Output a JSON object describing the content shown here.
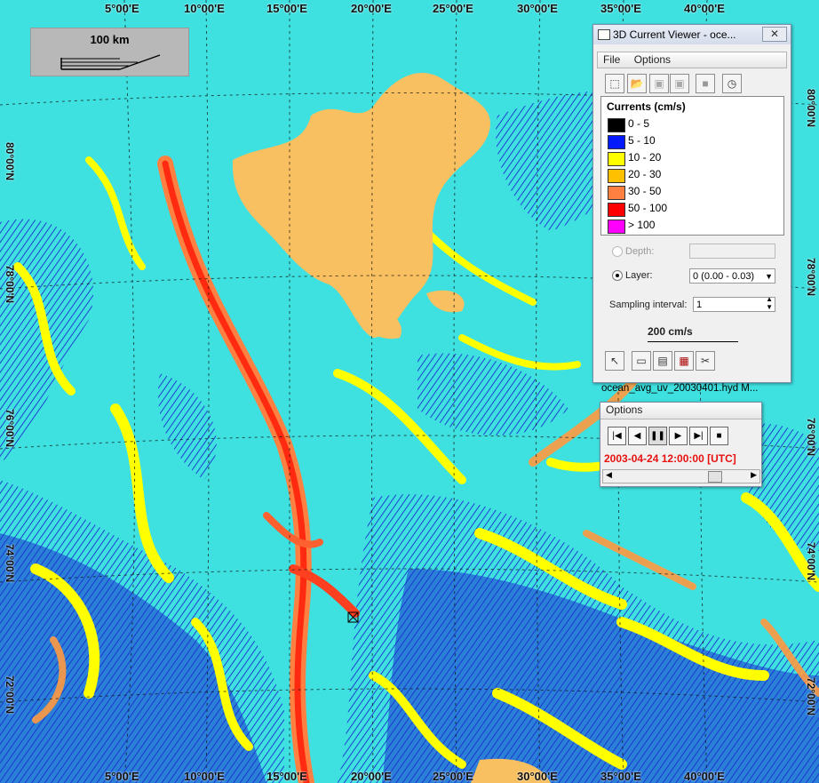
{
  "longitude_labels_top": [
    "5°00'E",
    "10°00'E",
    "15°00'E",
    "20°00'E",
    "25°00'E",
    "30°00'E",
    "35°00'E",
    "40°00'E"
  ],
  "longitude_labels_bottom": [
    "5°00'E",
    "10°00'E",
    "15°00'E",
    "20°00'E",
    "25°00'E",
    "30°00'E",
    "35°00'E",
    "40°00'E"
  ],
  "latitude_labels_left": [
    "80°00'N",
    "78°00'N",
    "76°00'N",
    "74°00'N",
    "72°00'N"
  ],
  "latitude_labels_right": [
    "80°00'N",
    "78°00'N",
    "76°00'N",
    "74°00'N",
    "72°00'N"
  ],
  "scale_bar": {
    "label": "100 km"
  },
  "viewer_window": {
    "title": "3D Current Viewer - oce...",
    "close_label": "✕",
    "menu": [
      "File",
      "Options"
    ],
    "legend_title": "Currents (cm/s)",
    "legend": [
      {
        "label": "0 -  5",
        "color": "#000000"
      },
      {
        "label": "5 - 10",
        "color": "#0019ff"
      },
      {
        "label": "10 - 20",
        "color": "#ffff00"
      },
      {
        "label": "20 - 30",
        "color": "#ffc000"
      },
      {
        "label": "30 - 50",
        "color": "#ff8040"
      },
      {
        "label": "50 - 100",
        "color": "#ff0000"
      },
      {
        "label": "> 100",
        "color": "#ff00ff"
      }
    ],
    "depth_label": "Depth:",
    "layer_label": "Layer:",
    "layer_value": "0 (0.00 - 0.03)",
    "sampling_label": "Sampling interval:",
    "sampling_value": "1",
    "vector_scale": "200 cm/s",
    "file_caption": "ocean_avg_uv_20030401.hyd M..."
  },
  "playback_window": {
    "title": "Options",
    "timestamp": "2003-04-24 12:00:00 [UTC]"
  },
  "map_colors": {
    "sea_background": "#3fe0e0",
    "land": "#f8c060",
    "slow_current": "#1a2fd0",
    "moderate_current": "#ffff00",
    "fast_current": "#ff8040",
    "very_fast_current": "#ff0000"
  }
}
